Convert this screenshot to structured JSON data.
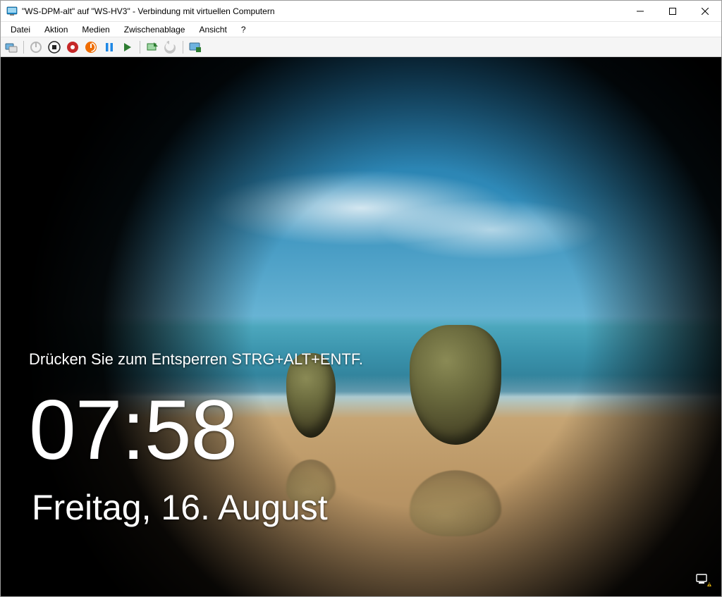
{
  "window": {
    "title": "\"WS-DPM-alt\" auf \"WS-HV3\" - Verbindung mit virtuellen Computern"
  },
  "menu": {
    "file": "Datei",
    "action": "Aktion",
    "media": "Medien",
    "clipboard": "Zwischenablage",
    "view": "Ansicht",
    "help": "?"
  },
  "toolbar": {
    "ctrl_alt_del": "ctrl-alt-del",
    "start": "start",
    "turnoff": "turn-off",
    "shutdown": "shutdown",
    "save": "save",
    "pause": "pause",
    "reset": "reset",
    "checkpoint": "checkpoint",
    "revert": "revert",
    "enhanced": "enhanced-session"
  },
  "lockscreen": {
    "hint": "Drücken Sie zum Entsperren STRG+ALT+ENTF.",
    "time": "07:58",
    "date": "Freitag, 16. August"
  }
}
